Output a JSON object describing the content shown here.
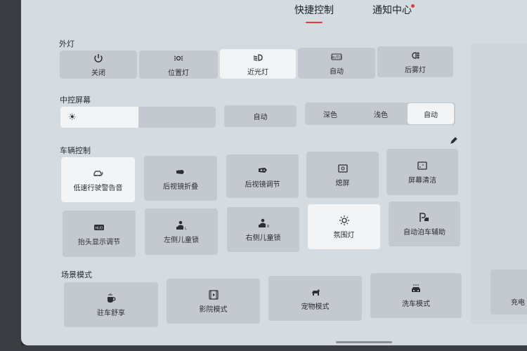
{
  "tabs": {
    "quick_controls": "快捷控制",
    "notification_center": "通知中心"
  },
  "sections": {
    "exterior_lights": {
      "label": "外灯",
      "items": [
        {
          "label": "关闭",
          "icon": "power-icon",
          "active": false
        },
        {
          "label": "位置灯",
          "icon": "position-light-icon",
          "active": false
        },
        {
          "label": "近光灯",
          "icon": "low-beam-icon",
          "active": true
        },
        {
          "label": "自动",
          "icon": "auto-light-icon",
          "active": false
        },
        {
          "label": "后雾灯",
          "icon": "rear-fog-light-icon",
          "active": false
        }
      ]
    },
    "center_screen": {
      "label": "中控屏幕",
      "brightness_level": 0.5,
      "auto_label": "自动",
      "theme_options": [
        "深色",
        "浅色",
        "自动"
      ],
      "theme_selected": "自动"
    },
    "vehicle_controls": {
      "label": "车辆控制",
      "row1": [
        {
          "label": "低速行驶警告音",
          "icon": "low-speed-warning-icon",
          "active": true
        },
        {
          "label": "后视镜折叠",
          "icon": "mirror-fold-icon",
          "active": false
        },
        {
          "label": "后视镜调节",
          "icon": "mirror-adjust-icon",
          "active": false
        },
        {
          "label": "熄屏",
          "icon": "screen-off-icon",
          "active": false
        },
        {
          "label": "屏幕清洁",
          "icon": "screen-clean-icon",
          "active": false
        }
      ],
      "row2": [
        {
          "label": "抬头显示调节",
          "icon": "hud-icon",
          "active": false
        },
        {
          "label": "左侧儿童锁",
          "icon": "left-child-lock-icon",
          "active": false
        },
        {
          "label": "右侧儿童锁",
          "icon": "right-child-lock-icon",
          "active": false
        },
        {
          "label": "氛围灯",
          "icon": "ambient-light-icon",
          "active": true
        },
        {
          "label": "自动泊车辅助",
          "icon": "auto-parking-icon",
          "active": false
        }
      ]
    },
    "scene_modes": {
      "label": "场景模式",
      "items": [
        {
          "label": "驻车舒享",
          "icon": "parking-comfort-icon"
        },
        {
          "label": "影院模式",
          "icon": "cinema-mode-icon"
        },
        {
          "label": "宠物模式",
          "icon": "pet-mode-icon"
        },
        {
          "label": "洗车模式",
          "icon": "car-wash-mode-icon"
        }
      ],
      "partial_item_label": "充电"
    }
  },
  "colors": {
    "accent": "#e23b3b",
    "tile": "#c3c9cf",
    "tile_active": "#f2f4f6",
    "background": "#d4dbe1"
  }
}
